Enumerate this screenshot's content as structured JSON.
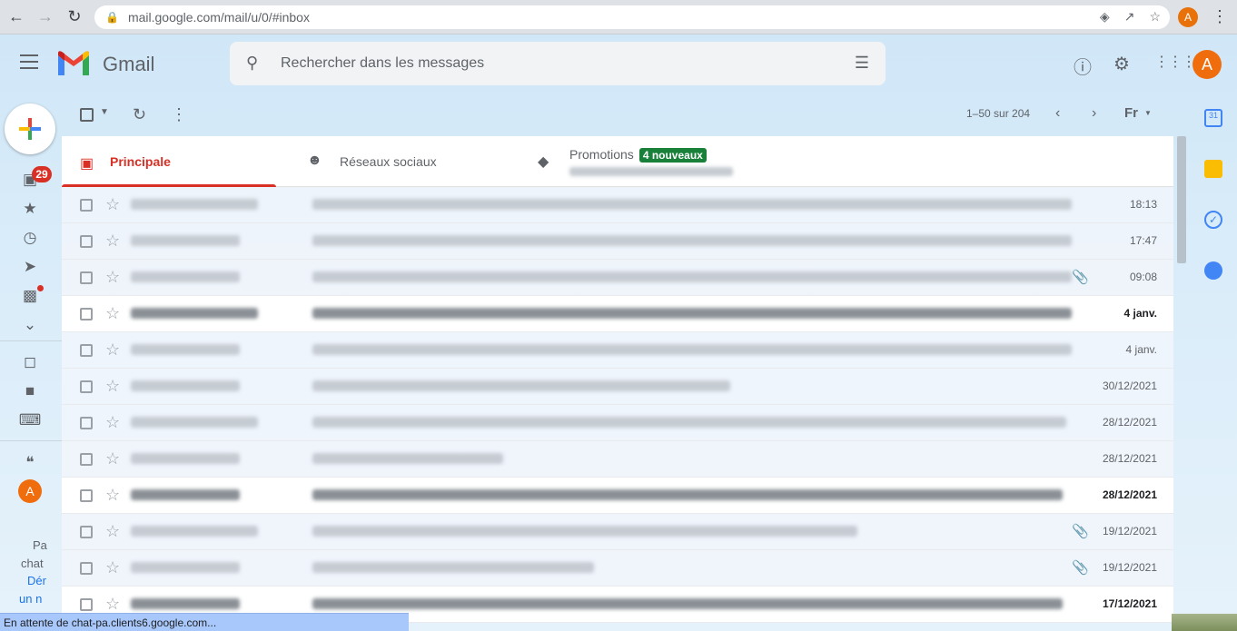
{
  "browser": {
    "url": "mail.google.com/mail/u/0/#inbox",
    "profile_initial": "A"
  },
  "header": {
    "app_name": "Gmail",
    "search_placeholder": "Rechercher dans les messages",
    "avatar_initial": "A"
  },
  "rail": {
    "inbox_badge": "29",
    "chat_avatar_initial": "A",
    "chat_text_1": "Pa",
    "chat_text_2": "chat",
    "chat_link_1": "Dér",
    "chat_link_2": "un n"
  },
  "toolbar": {
    "pagination": "1–50 sur 204",
    "lang_btn": "Fr"
  },
  "tabs": [
    {
      "label": "Principale",
      "active": true
    },
    {
      "label": "Réseaux sociaux",
      "active": false
    },
    {
      "label": "Promotions",
      "badge": "4 nouveaux",
      "active": false
    }
  ],
  "emails": [
    {
      "date": "18:13",
      "unread": false,
      "attachment": false
    },
    {
      "date": "17:47",
      "unread": false,
      "attachment": false
    },
    {
      "date": "09:08",
      "unread": false,
      "attachment": true
    },
    {
      "date": "4 janv.",
      "unread": true,
      "attachment": false
    },
    {
      "date": "4 janv.",
      "unread": false,
      "attachment": false
    },
    {
      "date": "30/12/2021",
      "unread": false,
      "attachment": false
    },
    {
      "date": "28/12/2021",
      "unread": false,
      "attachment": false
    },
    {
      "date": "28/12/2021",
      "unread": false,
      "attachment": false
    },
    {
      "date": "28/12/2021",
      "unread": true,
      "attachment": false
    },
    {
      "date": "19/12/2021",
      "unread": false,
      "attachment": true
    },
    {
      "date": "19/12/2021",
      "unread": false,
      "attachment": true
    },
    {
      "date": "17/12/2021",
      "unread": true,
      "attachment": false
    }
  ],
  "statusbar": {
    "text": "En attente de chat-pa.clients6.google.com..."
  },
  "colors": {
    "accent_red": "#d93025",
    "promo_green": "#188038",
    "avatar_orange": "#f06d0e"
  }
}
